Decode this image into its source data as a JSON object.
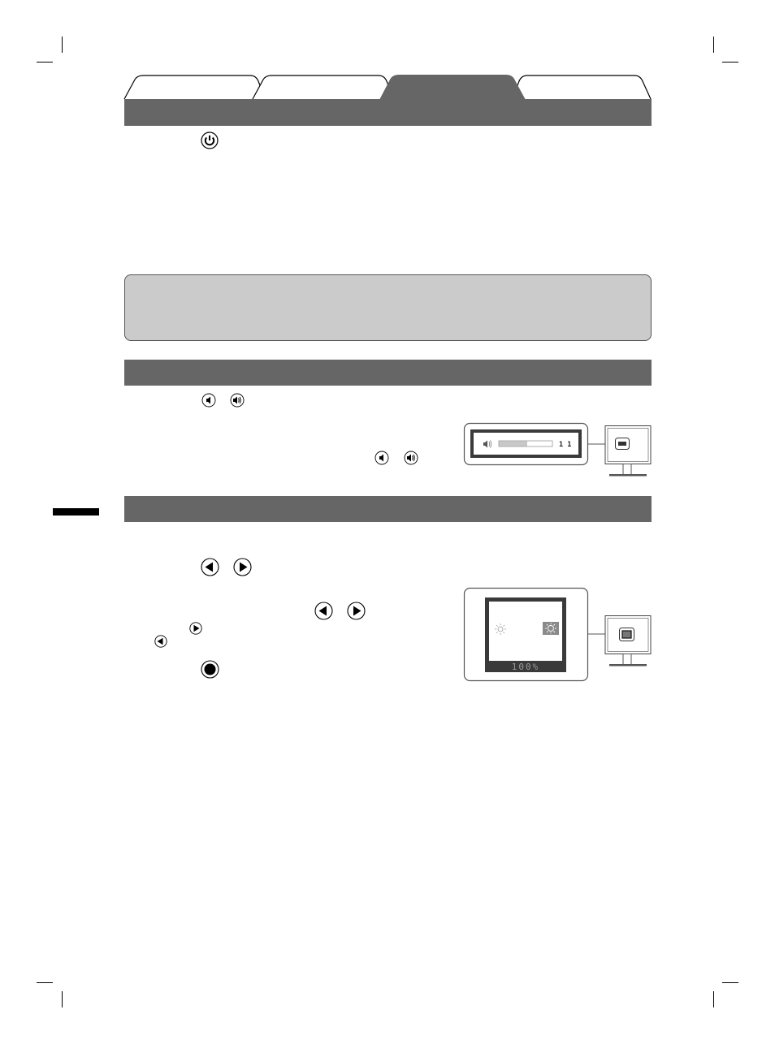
{
  "page": {
    "tabs": [
      {
        "label": "",
        "active": false
      },
      {
        "label": "",
        "active": false
      },
      {
        "label": "",
        "active": true
      },
      {
        "label": "",
        "active": false
      }
    ],
    "colors": {
      "section_bar": "#666666",
      "note_box_fill": "#cbcbcb",
      "osd_frame": "#3a3a3a",
      "volume_fill": "#c8c8c8"
    }
  },
  "sections": {
    "power": {
      "button_icon": "power-icon"
    },
    "note": {
      "text": ""
    },
    "volume": {
      "button_icons": [
        "volume-down-icon",
        "volume-up-icon"
      ],
      "instruction_icons": [
        "volume-down-icon",
        "volume-up-icon"
      ],
      "osd": {
        "icon": "speaker-icon",
        "value_label": "1 1",
        "level_fraction": 0.53
      }
    },
    "brightness": {
      "button_icons": [
        "left-arrow-icon",
        "right-arrow-icon"
      ],
      "instruction_icons": [
        "left-arrow-icon",
        "right-arrow-icon"
      ],
      "inline_right_icon": "right-arrow-icon",
      "inline_left_icon": "left-arrow-icon",
      "enter_icon": "enter-icon",
      "osd": {
        "dim_icon": "sun-small-icon",
        "bright_icon": "sun-large-icon",
        "value_label": "100%"
      }
    }
  }
}
